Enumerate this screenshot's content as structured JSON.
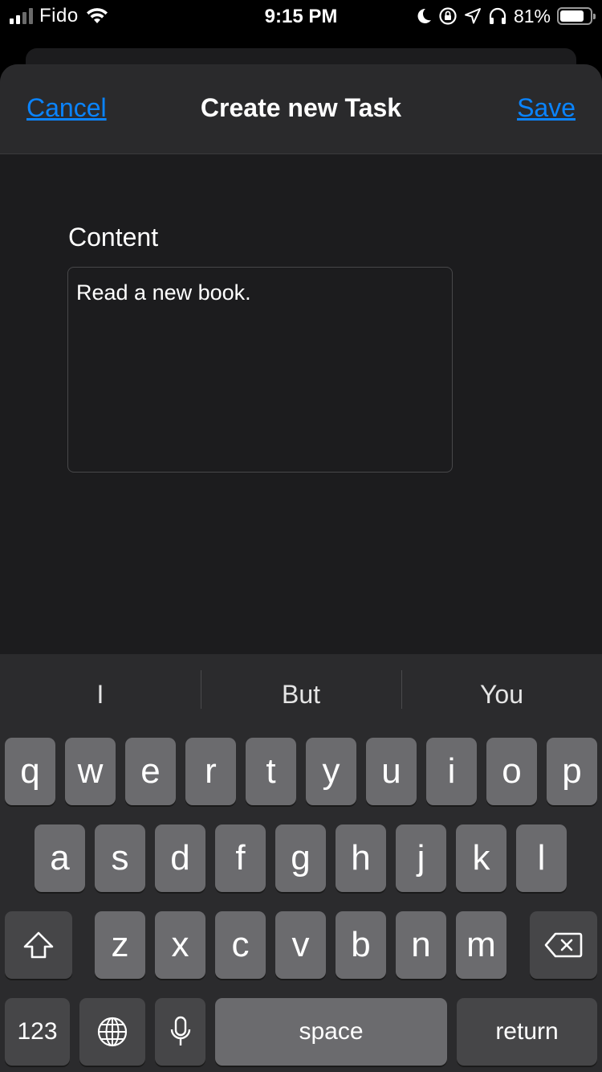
{
  "status_bar": {
    "carrier": "Fido",
    "time": "9:15 PM",
    "battery_percent": "81%",
    "battery_level": 0.81,
    "icons": [
      "signal-icon",
      "wifi-icon",
      "moon-icon",
      "rotation-lock-icon",
      "location-icon",
      "headphones-icon",
      "battery-icon"
    ]
  },
  "nav": {
    "cancel_label": "Cancel",
    "title": "Create new Task",
    "save_label": "Save"
  },
  "form": {
    "content_label": "Content",
    "content_value": "Read a new book."
  },
  "keyboard": {
    "suggestions": [
      "I",
      "But",
      "You"
    ],
    "row1": [
      "q",
      "w",
      "e",
      "r",
      "t",
      "y",
      "u",
      "i",
      "o",
      "p"
    ],
    "row2": [
      "a",
      "s",
      "d",
      "f",
      "g",
      "h",
      "j",
      "k",
      "l"
    ],
    "row3": [
      "z",
      "x",
      "c",
      "v",
      "b",
      "n",
      "m"
    ],
    "numbers_label": "123",
    "space_label": "space",
    "return_label": "return",
    "icons": [
      "shift-icon",
      "backspace-icon",
      "globe-icon",
      "microphone-icon"
    ]
  },
  "colors": {
    "accent": "#0a84ff",
    "background": "#1c1c1e",
    "key": "#6b6b6e",
    "key_dark": "#464648"
  }
}
